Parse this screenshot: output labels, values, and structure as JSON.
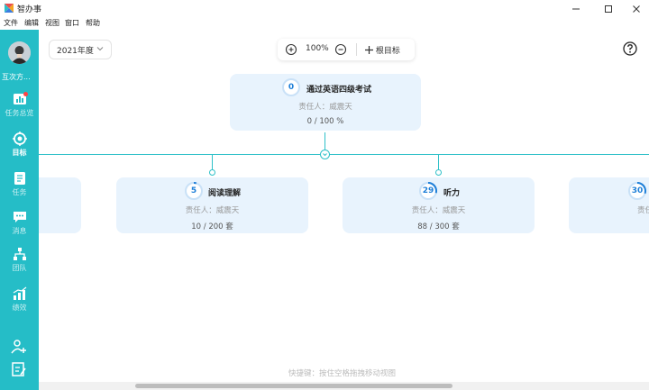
{
  "window": {
    "title": "智办事",
    "menu": [
      "文件",
      "编辑",
      "视图",
      "窗口",
      "帮助"
    ]
  },
  "sidebar": {
    "team_name": "互次方...",
    "items": [
      {
        "label": "任务总览",
        "icon": "dashboard-icon",
        "active": false,
        "badge": true
      },
      {
        "label": "目标",
        "icon": "target-icon",
        "active": true,
        "badge": false
      },
      {
        "label": "任务",
        "icon": "task-icon",
        "active": false,
        "badge": false
      },
      {
        "label": "消息",
        "icon": "message-icon",
        "active": false,
        "badge": false
      },
      {
        "label": "团队",
        "icon": "team-icon",
        "active": false,
        "badge": false
      },
      {
        "label": "绩效",
        "icon": "performance-icon",
        "active": false,
        "badge": false
      }
    ],
    "bottom_icons": [
      "add-member-icon",
      "edit-note-icon"
    ]
  },
  "toolbar": {
    "year": "2021年度",
    "zoom": "100%",
    "add_root": "根目标"
  },
  "goals": {
    "root": {
      "count": "0",
      "title": "通过英语四级考试",
      "owner": "责任人：威震天",
      "progress": "0 / 100 %",
      "fraction": 0
    },
    "children": [
      {
        "count": "5",
        "title": "阅读理解",
        "owner": "责任人：威震天",
        "progress": "10 / 200 套",
        "fraction": 0.05
      },
      {
        "count": "29",
        "title": "听力",
        "owner": "责任人：威震天",
        "progress": "88 / 300 套",
        "fraction": 0.29
      },
      {
        "count": "30",
        "title": "",
        "owner": "责任",
        "progress": "",
        "fraction": 0.3
      }
    ]
  },
  "hint": "快捷键：按住空格拖拽移动视图",
  "colors": {
    "sidebar": "#25bdc7",
    "card": "#e8f3fd",
    "accent": "#1e7fd8",
    "line": "#2ec0c8"
  }
}
